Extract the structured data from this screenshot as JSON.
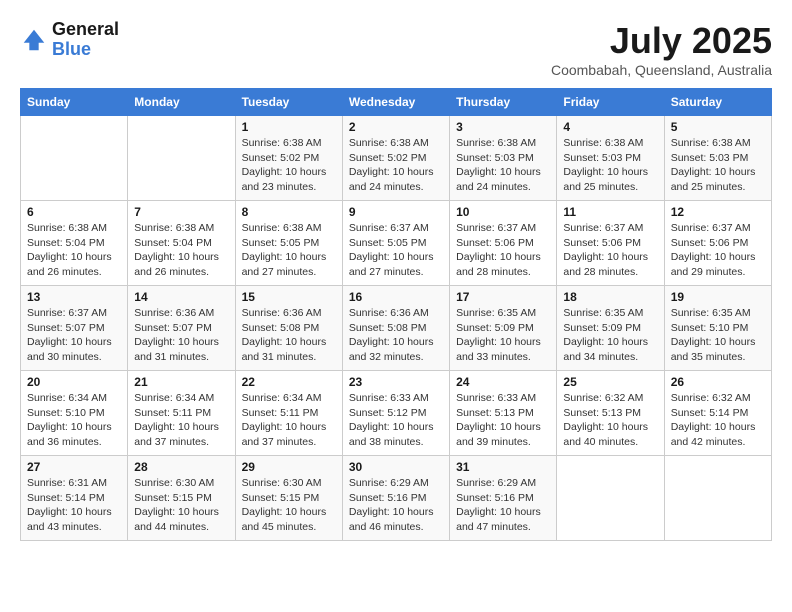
{
  "header": {
    "logo_line1": "General",
    "logo_line2": "Blue",
    "month": "July 2025",
    "location": "Coombabah, Queensland, Australia"
  },
  "weekdays": [
    "Sunday",
    "Monday",
    "Tuesday",
    "Wednesday",
    "Thursday",
    "Friday",
    "Saturday"
  ],
  "weeks": [
    [
      {
        "day": "",
        "info": ""
      },
      {
        "day": "",
        "info": ""
      },
      {
        "day": "1",
        "info": "Sunrise: 6:38 AM\nSunset: 5:02 PM\nDaylight: 10 hours and 23 minutes."
      },
      {
        "day": "2",
        "info": "Sunrise: 6:38 AM\nSunset: 5:02 PM\nDaylight: 10 hours and 24 minutes."
      },
      {
        "day": "3",
        "info": "Sunrise: 6:38 AM\nSunset: 5:03 PM\nDaylight: 10 hours and 24 minutes."
      },
      {
        "day": "4",
        "info": "Sunrise: 6:38 AM\nSunset: 5:03 PM\nDaylight: 10 hours and 25 minutes."
      },
      {
        "day": "5",
        "info": "Sunrise: 6:38 AM\nSunset: 5:03 PM\nDaylight: 10 hours and 25 minutes."
      }
    ],
    [
      {
        "day": "6",
        "info": "Sunrise: 6:38 AM\nSunset: 5:04 PM\nDaylight: 10 hours and 26 minutes."
      },
      {
        "day": "7",
        "info": "Sunrise: 6:38 AM\nSunset: 5:04 PM\nDaylight: 10 hours and 26 minutes."
      },
      {
        "day": "8",
        "info": "Sunrise: 6:38 AM\nSunset: 5:05 PM\nDaylight: 10 hours and 27 minutes."
      },
      {
        "day": "9",
        "info": "Sunrise: 6:37 AM\nSunset: 5:05 PM\nDaylight: 10 hours and 27 minutes."
      },
      {
        "day": "10",
        "info": "Sunrise: 6:37 AM\nSunset: 5:06 PM\nDaylight: 10 hours and 28 minutes."
      },
      {
        "day": "11",
        "info": "Sunrise: 6:37 AM\nSunset: 5:06 PM\nDaylight: 10 hours and 28 minutes."
      },
      {
        "day": "12",
        "info": "Sunrise: 6:37 AM\nSunset: 5:06 PM\nDaylight: 10 hours and 29 minutes."
      }
    ],
    [
      {
        "day": "13",
        "info": "Sunrise: 6:37 AM\nSunset: 5:07 PM\nDaylight: 10 hours and 30 minutes."
      },
      {
        "day": "14",
        "info": "Sunrise: 6:36 AM\nSunset: 5:07 PM\nDaylight: 10 hours and 31 minutes."
      },
      {
        "day": "15",
        "info": "Sunrise: 6:36 AM\nSunset: 5:08 PM\nDaylight: 10 hours and 31 minutes."
      },
      {
        "day": "16",
        "info": "Sunrise: 6:36 AM\nSunset: 5:08 PM\nDaylight: 10 hours and 32 minutes."
      },
      {
        "day": "17",
        "info": "Sunrise: 6:35 AM\nSunset: 5:09 PM\nDaylight: 10 hours and 33 minutes."
      },
      {
        "day": "18",
        "info": "Sunrise: 6:35 AM\nSunset: 5:09 PM\nDaylight: 10 hours and 34 minutes."
      },
      {
        "day": "19",
        "info": "Sunrise: 6:35 AM\nSunset: 5:10 PM\nDaylight: 10 hours and 35 minutes."
      }
    ],
    [
      {
        "day": "20",
        "info": "Sunrise: 6:34 AM\nSunset: 5:10 PM\nDaylight: 10 hours and 36 minutes."
      },
      {
        "day": "21",
        "info": "Sunrise: 6:34 AM\nSunset: 5:11 PM\nDaylight: 10 hours and 37 minutes."
      },
      {
        "day": "22",
        "info": "Sunrise: 6:34 AM\nSunset: 5:11 PM\nDaylight: 10 hours and 37 minutes."
      },
      {
        "day": "23",
        "info": "Sunrise: 6:33 AM\nSunset: 5:12 PM\nDaylight: 10 hours and 38 minutes."
      },
      {
        "day": "24",
        "info": "Sunrise: 6:33 AM\nSunset: 5:13 PM\nDaylight: 10 hours and 39 minutes."
      },
      {
        "day": "25",
        "info": "Sunrise: 6:32 AM\nSunset: 5:13 PM\nDaylight: 10 hours and 40 minutes."
      },
      {
        "day": "26",
        "info": "Sunrise: 6:32 AM\nSunset: 5:14 PM\nDaylight: 10 hours and 42 minutes."
      }
    ],
    [
      {
        "day": "27",
        "info": "Sunrise: 6:31 AM\nSunset: 5:14 PM\nDaylight: 10 hours and 43 minutes."
      },
      {
        "day": "28",
        "info": "Sunrise: 6:30 AM\nSunset: 5:15 PM\nDaylight: 10 hours and 44 minutes."
      },
      {
        "day": "29",
        "info": "Sunrise: 6:30 AM\nSunset: 5:15 PM\nDaylight: 10 hours and 45 minutes."
      },
      {
        "day": "30",
        "info": "Sunrise: 6:29 AM\nSunset: 5:16 PM\nDaylight: 10 hours and 46 minutes."
      },
      {
        "day": "31",
        "info": "Sunrise: 6:29 AM\nSunset: 5:16 PM\nDaylight: 10 hours and 47 minutes."
      },
      {
        "day": "",
        "info": ""
      },
      {
        "day": "",
        "info": ""
      }
    ]
  ]
}
